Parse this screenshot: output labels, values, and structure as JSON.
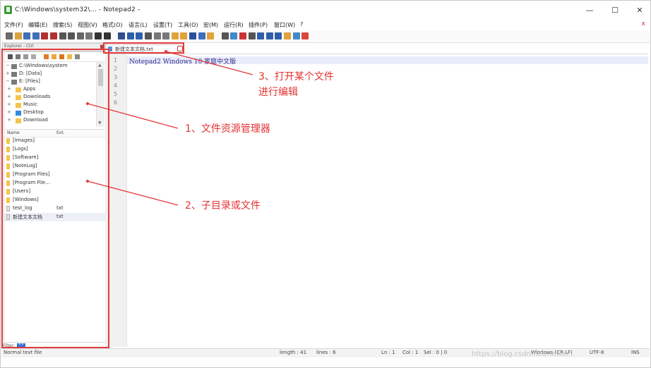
{
  "window": {
    "title": "C:\\Windows\\system32\\...  - Notepad2 -",
    "minimize_symbol": "—",
    "maximize_symbol": "☐",
    "close_symbol": "✕"
  },
  "menu": {
    "items": [
      "文件(F)",
      "编辑(E)",
      "搜索(S)",
      "视图(V)",
      "格式(O)",
      "语言(L)",
      "设置(T)",
      "工具(O)",
      "宏(M)",
      "运行(R)",
      "插件(P)",
      "窗口(W)",
      "?"
    ],
    "close_symbol": "x"
  },
  "toolbar": {
    "icons": [
      "new-icon",
      "open-icon",
      "save-icon",
      "save-all-icon",
      "close-icon",
      "close-all-icon",
      "print-icon",
      "cut-icon",
      "copy-icon",
      "paste-icon",
      "undo-icon",
      "redo-icon",
      "find-icon",
      "replace-icon",
      "zoom-in-icon",
      "zoom-out-icon",
      "sync-v-icon",
      "sync-h-icon",
      "wrap-icon",
      "all-chars-icon",
      "indent-guide-icon",
      "doc-map-icon",
      "function-list-icon",
      "folder-workspace-icon",
      "monitor-icon",
      "record-icon",
      "stop-icon",
      "play-icon",
      "play-multiple-icon",
      "save-macro-icon",
      "spell-icon",
      "highlight-icon",
      "heart-icon"
    ]
  },
  "explorer": {
    "tab_label": "Explorer - Ctrl",
    "tree": [
      {
        "label": "C:\\Windows\\system",
        "indent": 0,
        "expander": "−"
      },
      {
        "label": "D: [Data]",
        "indent": 0,
        "expander": "+"
      },
      {
        "label": "E: [Files]",
        "indent": 0,
        "expander": "−"
      },
      {
        "label": "Apps",
        "indent": 1,
        "expander": "+"
      },
      {
        "label": "Downloads",
        "indent": 1,
        "expander": "+"
      },
      {
        "label": "Music",
        "indent": 1,
        "expander": "+"
      },
      {
        "label": "Desktop",
        "indent": 1,
        "expander": "+"
      },
      {
        "label": "Download",
        "indent": 1,
        "expander": "+"
      }
    ],
    "list_headers": {
      "name": "Name",
      "ext": "Ext."
    },
    "files": [
      {
        "name": "[Images]",
        "ext": "",
        "type": "folder"
      },
      {
        "name": "[Logs]",
        "ext": "",
        "type": "folder"
      },
      {
        "name": "[Software]",
        "ext": "",
        "type": "folder"
      },
      {
        "name": "[NoteLog]",
        "ext": "",
        "type": "folder"
      },
      {
        "name": "[Program Files]",
        "ext": "",
        "type": "folder"
      },
      {
        "name": "[Program File...",
        "ext": "",
        "type": "folder"
      },
      {
        "name": "[Users]",
        "ext": "",
        "type": "folder"
      },
      {
        "name": "[Windows]",
        "ext": "",
        "type": "folder"
      },
      {
        "name": "test_log",
        "ext": "txt",
        "type": "file"
      },
      {
        "name": "新建文本文档",
        "ext": "txt",
        "type": "file"
      }
    ],
    "filter_label": "Filter:",
    "filter_value": "*.*"
  },
  "editor": {
    "tab_label": "新建文本文档.txt",
    "lines": [
      "1",
      "2",
      "3",
      "4",
      "5",
      "6"
    ],
    "content": "Notepad2 Windows 10 家庭中文版"
  },
  "statusbar": {
    "type": "Normal text file",
    "length": "length : 41",
    "lines": "lines : 6",
    "ln": "Ln : 1",
    "col": "Col : 1",
    "sel": "Sel : 0 | 0",
    "eol": "Windows (CR LF)",
    "encoding": "UTF-8",
    "mode": "INS"
  },
  "annotations": {
    "a1": "1、文件资源管理器",
    "a2": "2、子目录或文件",
    "a3_line1": "3、打开某个文件",
    "a3_line2": "进行编辑",
    "color": "#e23a3a"
  },
  "watermark": "https://blog.csdn.net/newer..."
}
